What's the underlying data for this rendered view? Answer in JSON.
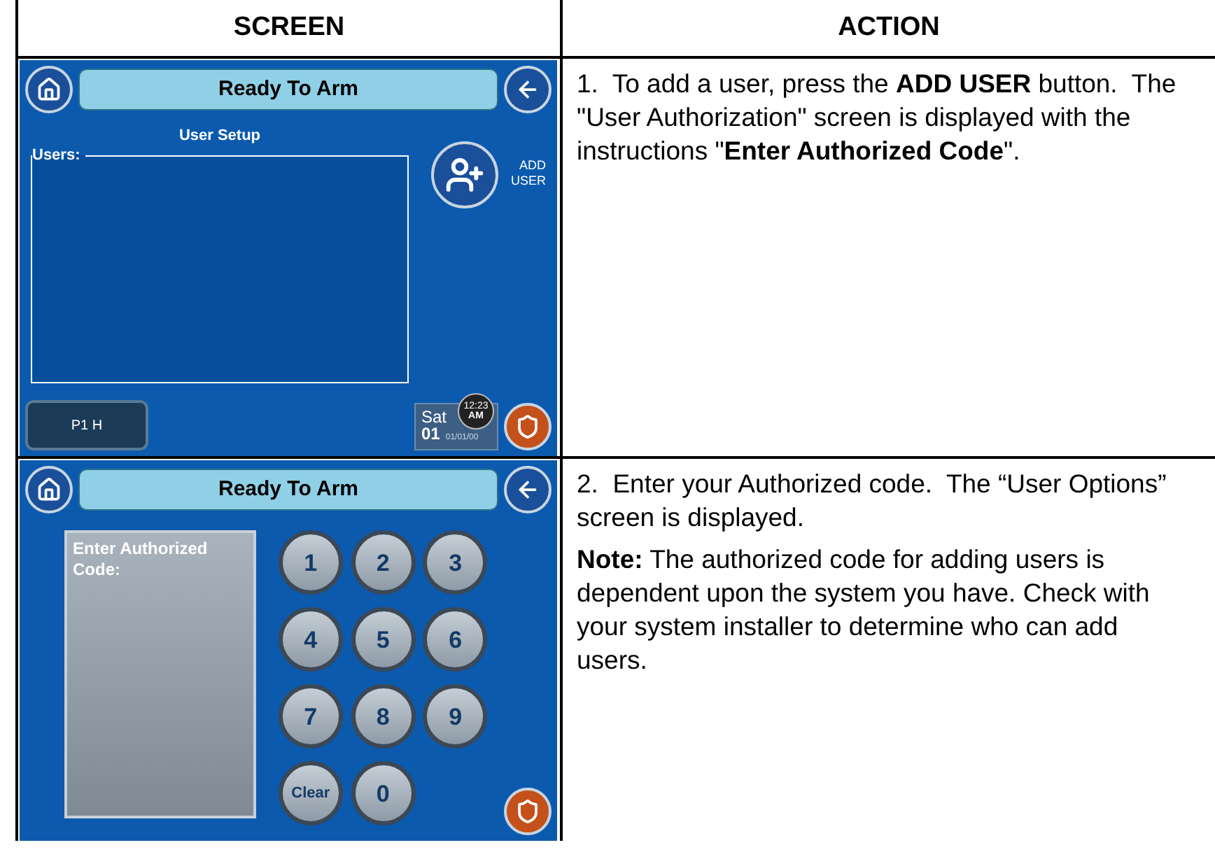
{
  "columns": [
    "SCREEN",
    "ACTION"
  ],
  "steps": [
    {
      "screen": {
        "kind": "user_setup",
        "title": "Ready To Arm",
        "heading": "User Setup",
        "list_label": "Users:",
        "add_label": "ADD USER",
        "partition_button": "P1 H",
        "day": "Sat",
        "date_number": "01",
        "date": "01/01/00",
        "time": "12:23",
        "meridiem": "AM"
      },
      "action": [
        "1.  To add a user, press the **ADD USER** button.  The \"User Authorization\" screen is displayed with the instructions \"**Enter Authorized Code**\"."
      ]
    },
    {
      "screen": {
        "kind": "keypad",
        "title": "Ready To Arm",
        "prompt": "Enter Authorized Code:",
        "keys": [
          "1",
          "2",
          "3",
          "4",
          "5",
          "6",
          "7",
          "8",
          "9",
          "Clear",
          "0"
        ]
      },
      "action": [
        "2.  Enter your Authorized code.  The “User Options” screen is displayed.",
        "**Note:** The authorized code for adding users is dependent upon the system you have. Check with your system installer to determine who can add users."
      ]
    }
  ]
}
